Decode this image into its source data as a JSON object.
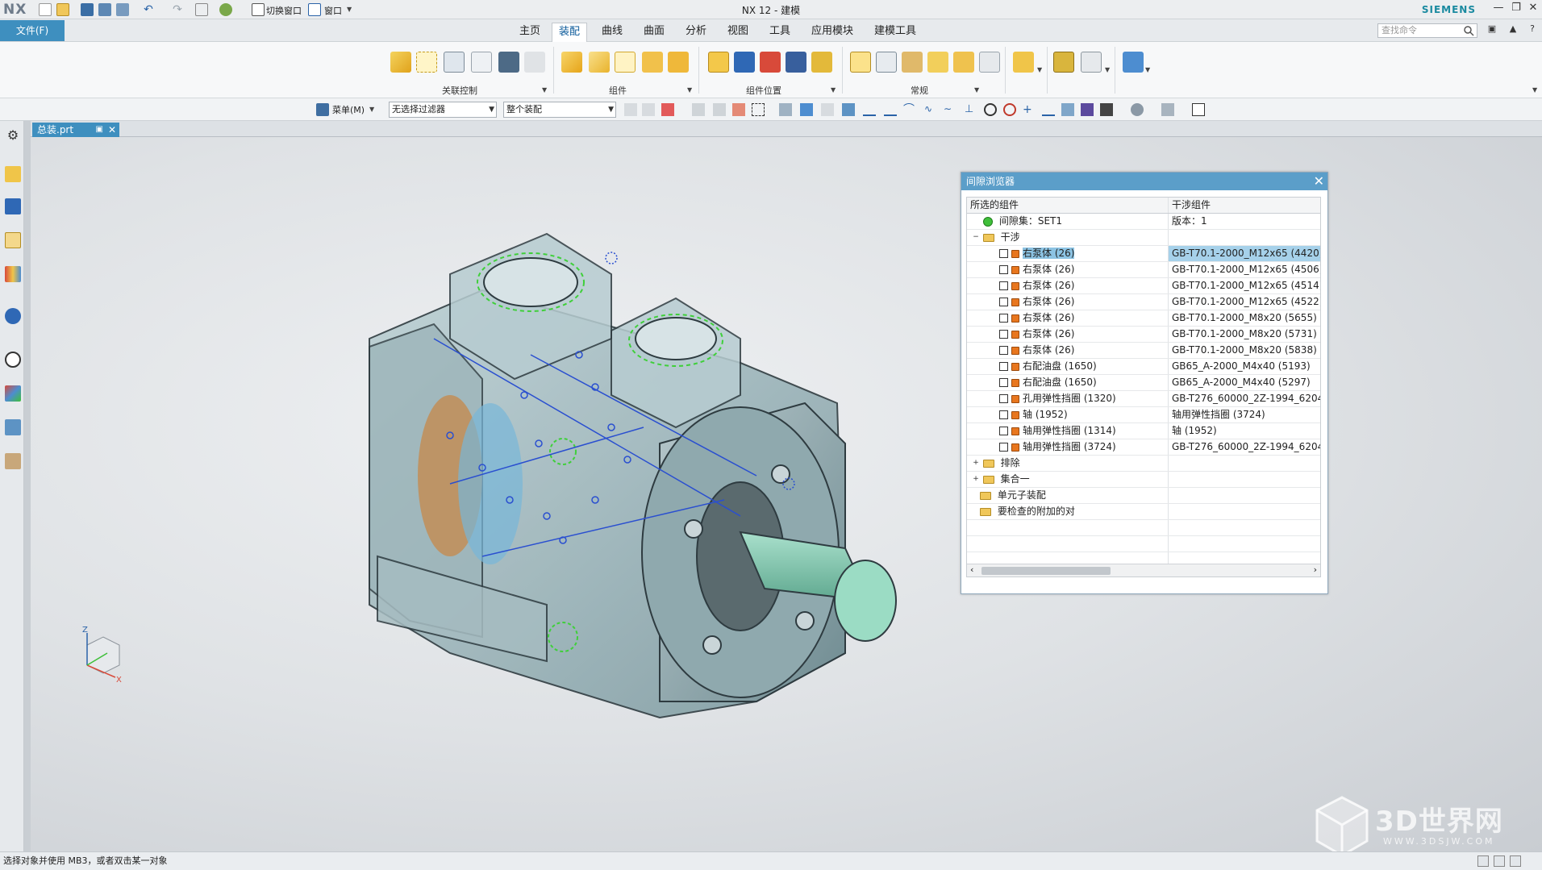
{
  "titlebar": {
    "logo": "NX",
    "title": "NX 12 - 建模",
    "brand": "SIEMENS",
    "switch_window": "切换窗口",
    "window_menu": "窗口"
  },
  "tabs": {
    "file": "文件(F)",
    "items": [
      "主页",
      "装配",
      "曲线",
      "曲面",
      "分析",
      "视图",
      "工具",
      "应用模块",
      "建模工具"
    ],
    "active": "装配",
    "search_placeholder": "查找命令"
  },
  "ribbon": {
    "groups": [
      "关联控制",
      "组件",
      "组件位置",
      "常规"
    ]
  },
  "toolbar2": {
    "menu": "菜单(M)",
    "filter": "无选择过滤器",
    "scope": "整个装配"
  },
  "document": {
    "tab": "总装.prt"
  },
  "clearance_browser": {
    "title": "间隙浏览器",
    "col_selected": "所选的组件",
    "col_interfering": "干涉组件",
    "set_row": {
      "label": "间隙集：SET1",
      "value": "版本：1"
    },
    "interference_folder": "干涉",
    "rows": [
      {
        "label": "右泵体 (26)",
        "value": "GB-T70.1-2000_M12x65 (4420)"
      },
      {
        "label": "右泵体 (26)",
        "value": "GB-T70.1-2000_M12x65 (4506)"
      },
      {
        "label": "右泵体 (26)",
        "value": "GB-T70.1-2000_M12x65 (4514)"
      },
      {
        "label": "右泵体 (26)",
        "value": "GB-T70.1-2000_M12x65 (4522)"
      },
      {
        "label": "右泵体 (26)",
        "value": "GB-T70.1-2000_M8x20 (5655)"
      },
      {
        "label": "右泵体 (26)",
        "value": "GB-T70.1-2000_M8x20 (5731)"
      },
      {
        "label": "右泵体 (26)",
        "value": "GB-T70.1-2000_M8x20 (5838)"
      },
      {
        "label": "右配油盘 (1650)",
        "value": "GB65_A-2000_M4x40 (5193)"
      },
      {
        "label": "右配油盘 (1650)",
        "value": "GB65_A-2000_M4x40 (5297)"
      },
      {
        "label": "孔用弹性挡圈 (1320)",
        "value": "GB-T276_60000_2Z-1994_6204 ("
      },
      {
        "label": "轴 (1952)",
        "value": "轴用弹性挡圈 (3724)"
      },
      {
        "label": "轴用弹性挡圈 (1314)",
        "value": "轴 (1952)"
      },
      {
        "label": "轴用弹性挡圈 (3724)",
        "value": "GB-T276_60000_2Z-1994_6204 ("
      }
    ],
    "other_folders": [
      "排除",
      "集合一",
      "单元子装配",
      "要检查的附加的对"
    ]
  },
  "statusbar": {
    "message": "选择对象并使用 MB3，或者双击某一对象"
  },
  "watermark": {
    "text": "3D世界网",
    "sub": "WWW.3DSJW.COM"
  },
  "triad": {
    "z": "Z",
    "x": "X"
  },
  "colors": {
    "accent": "#3e8fbf",
    "panel_title": "#5b9ec9",
    "selection": "#8cc3e3",
    "brand": "#1a8aa0"
  }
}
